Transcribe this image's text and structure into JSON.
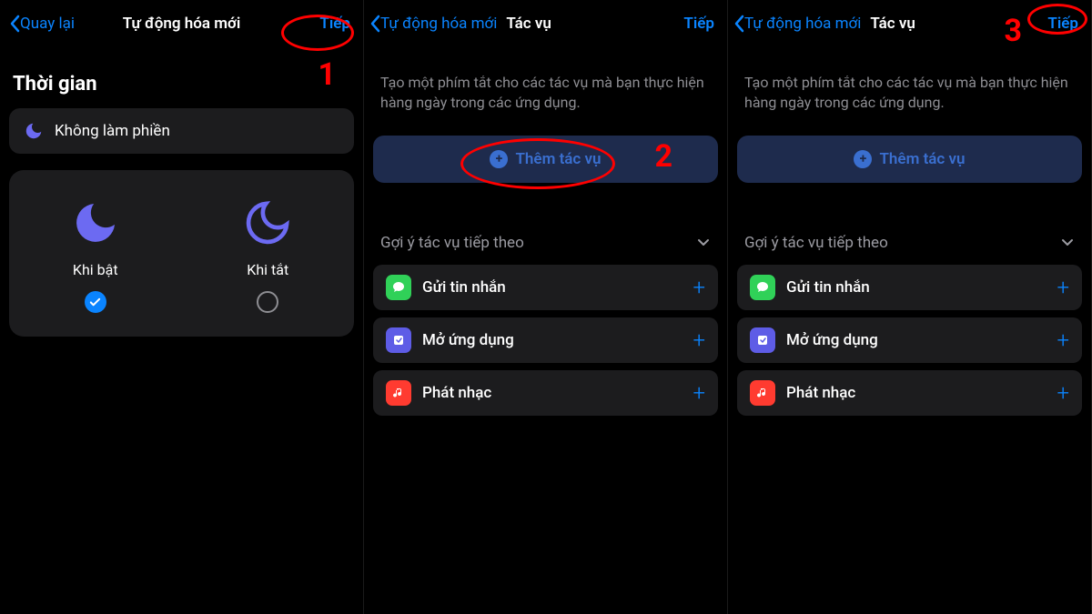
{
  "pane1": {
    "back": "Quay lại",
    "title": "Tự động hóa mới",
    "next": "Tiếp",
    "section": "Thời gian",
    "dnd": "Không làm phiền",
    "opt_on": "Khi bật",
    "opt_off": "Khi tắt",
    "annotation": "1"
  },
  "pane2": {
    "back": "Tự động hóa mới",
    "title": "Tác vụ",
    "next": "Tiếp",
    "desc": "Tạo một phím tắt cho các tác vụ mà bạn thực hiện hàng ngày trong các ứng dụng.",
    "add": "Thêm tác vụ",
    "suggest": "Gợi ý tác vụ tiếp theo",
    "actions": {
      "msg": "Gửi tin nhắn",
      "app": "Mở ứng dụng",
      "music": "Phát nhạc"
    },
    "annotation": "2"
  },
  "pane3": {
    "back": "Tự động hóa mới",
    "title": "Tác vụ",
    "next": "Tiếp",
    "desc": "Tạo một phím tắt cho các tác vụ mà bạn thực hiện hàng ngày trong các ứng dụng.",
    "add": "Thêm tác vụ",
    "suggest": "Gợi ý tác vụ tiếp theo",
    "actions": {
      "msg": "Gửi tin nhắn",
      "app": "Mở ứng dụng",
      "music": "Phát nhạc"
    },
    "annotation": "3"
  },
  "colors": {
    "accent": "#0a84ff",
    "moon_on": "#6c6af2",
    "moon_off": "#5e5ce6"
  }
}
